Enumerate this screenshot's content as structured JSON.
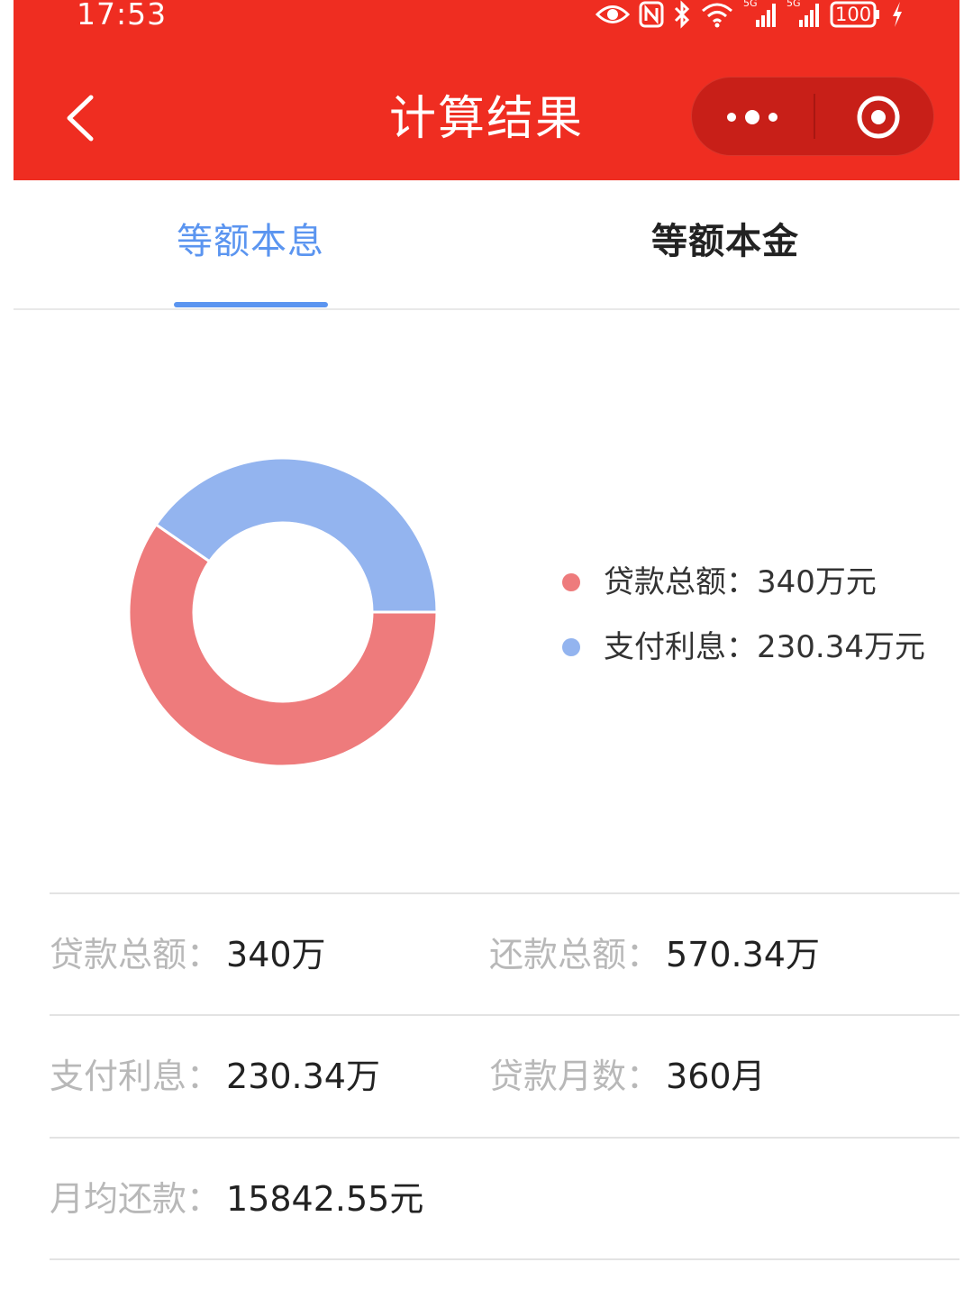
{
  "status_bar": {
    "time": "17:53",
    "battery": "100",
    "signal_1": "5G",
    "signal_2": "5G"
  },
  "nav": {
    "title": "计算结果",
    "back_icon": "chevron-left-icon",
    "more_icon": "more-dots-icon",
    "close_icon": "record-circle-icon"
  },
  "tabs": [
    {
      "label": "等额本息",
      "active": true
    },
    {
      "label": "等额本金",
      "active": false
    }
  ],
  "colors": {
    "header": "#ef2d21",
    "active_tab": "#5b95f0",
    "principal": "#ee7b7c",
    "interest": "#93b4ef"
  },
  "chart_data": {
    "type": "pie",
    "donut": true,
    "series": [
      {
        "name": "贷款总额",
        "value": 340,
        "unit": "万元",
        "color": "#ee7b7c"
      },
      {
        "name": "支付利息",
        "value": 230.34,
        "unit": "万元",
        "color": "#93b4ef"
      }
    ],
    "legend_items": [
      "贷款总额：340万元",
      "支付利息：230.34万元"
    ],
    "legend_position": "right"
  },
  "results": {
    "loan_total_label": "贷款总额：",
    "loan_total_value": "340万",
    "repay_total_label": "还款总额：",
    "repay_total_value": "570.34万",
    "interest_label": "支付利息：",
    "interest_value": "230.34万",
    "months_label": "贷款月数：",
    "months_value": "360月",
    "monthly_label": "月均还款：",
    "monthly_value": "15842.55元"
  }
}
